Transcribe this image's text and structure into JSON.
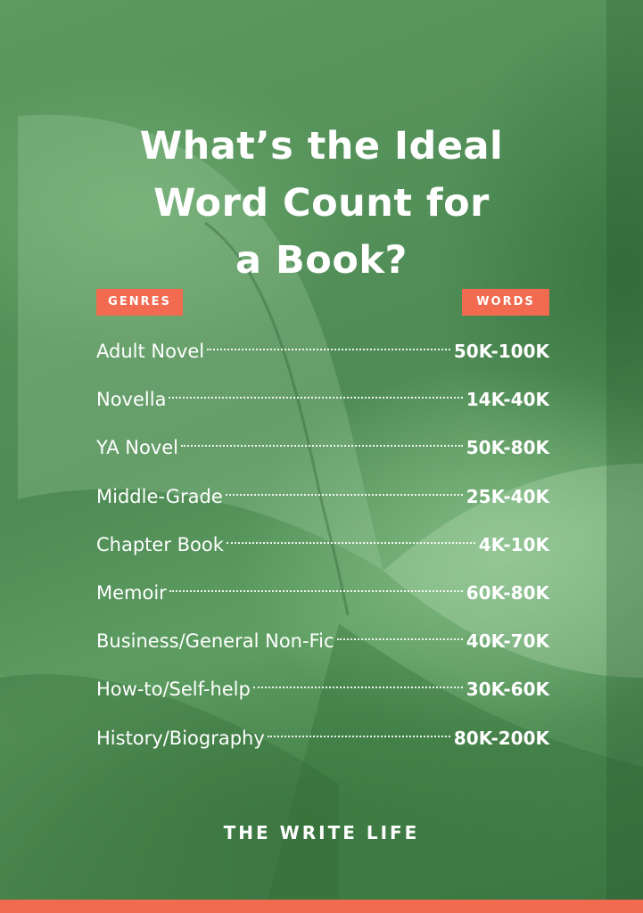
{
  "title_lines": [
    "What’s the Ideal",
    "Word Count for",
    "a Book?"
  ],
  "headers": {
    "genres": "GENRES",
    "words": "WORDS"
  },
  "rows": [
    {
      "genre": "Adult Novel",
      "words": "50K-100K"
    },
    {
      "genre": "Novella",
      "words": "14K-40K"
    },
    {
      "genre": "YA Novel",
      "words": "50K-80K"
    },
    {
      "genre": "Middle-Grade",
      "words": "25K-40K"
    },
    {
      "genre": "Chapter Book",
      "words": "4K-10K"
    },
    {
      "genre": "Memoir",
      "words": "60K-80K"
    },
    {
      "genre": "Business/General Non-Fic",
      "words": "40K-70K"
    },
    {
      "genre": "How-to/Self-help",
      "words": "30K-60K"
    },
    {
      "genre": "History/Biography",
      "words": "80K-200K"
    }
  ],
  "brand": "THE WRITE LIFE",
  "colors": {
    "background_green": "#4f8b55",
    "accent_orange": "#f26a4f",
    "text": "#ffffff"
  }
}
